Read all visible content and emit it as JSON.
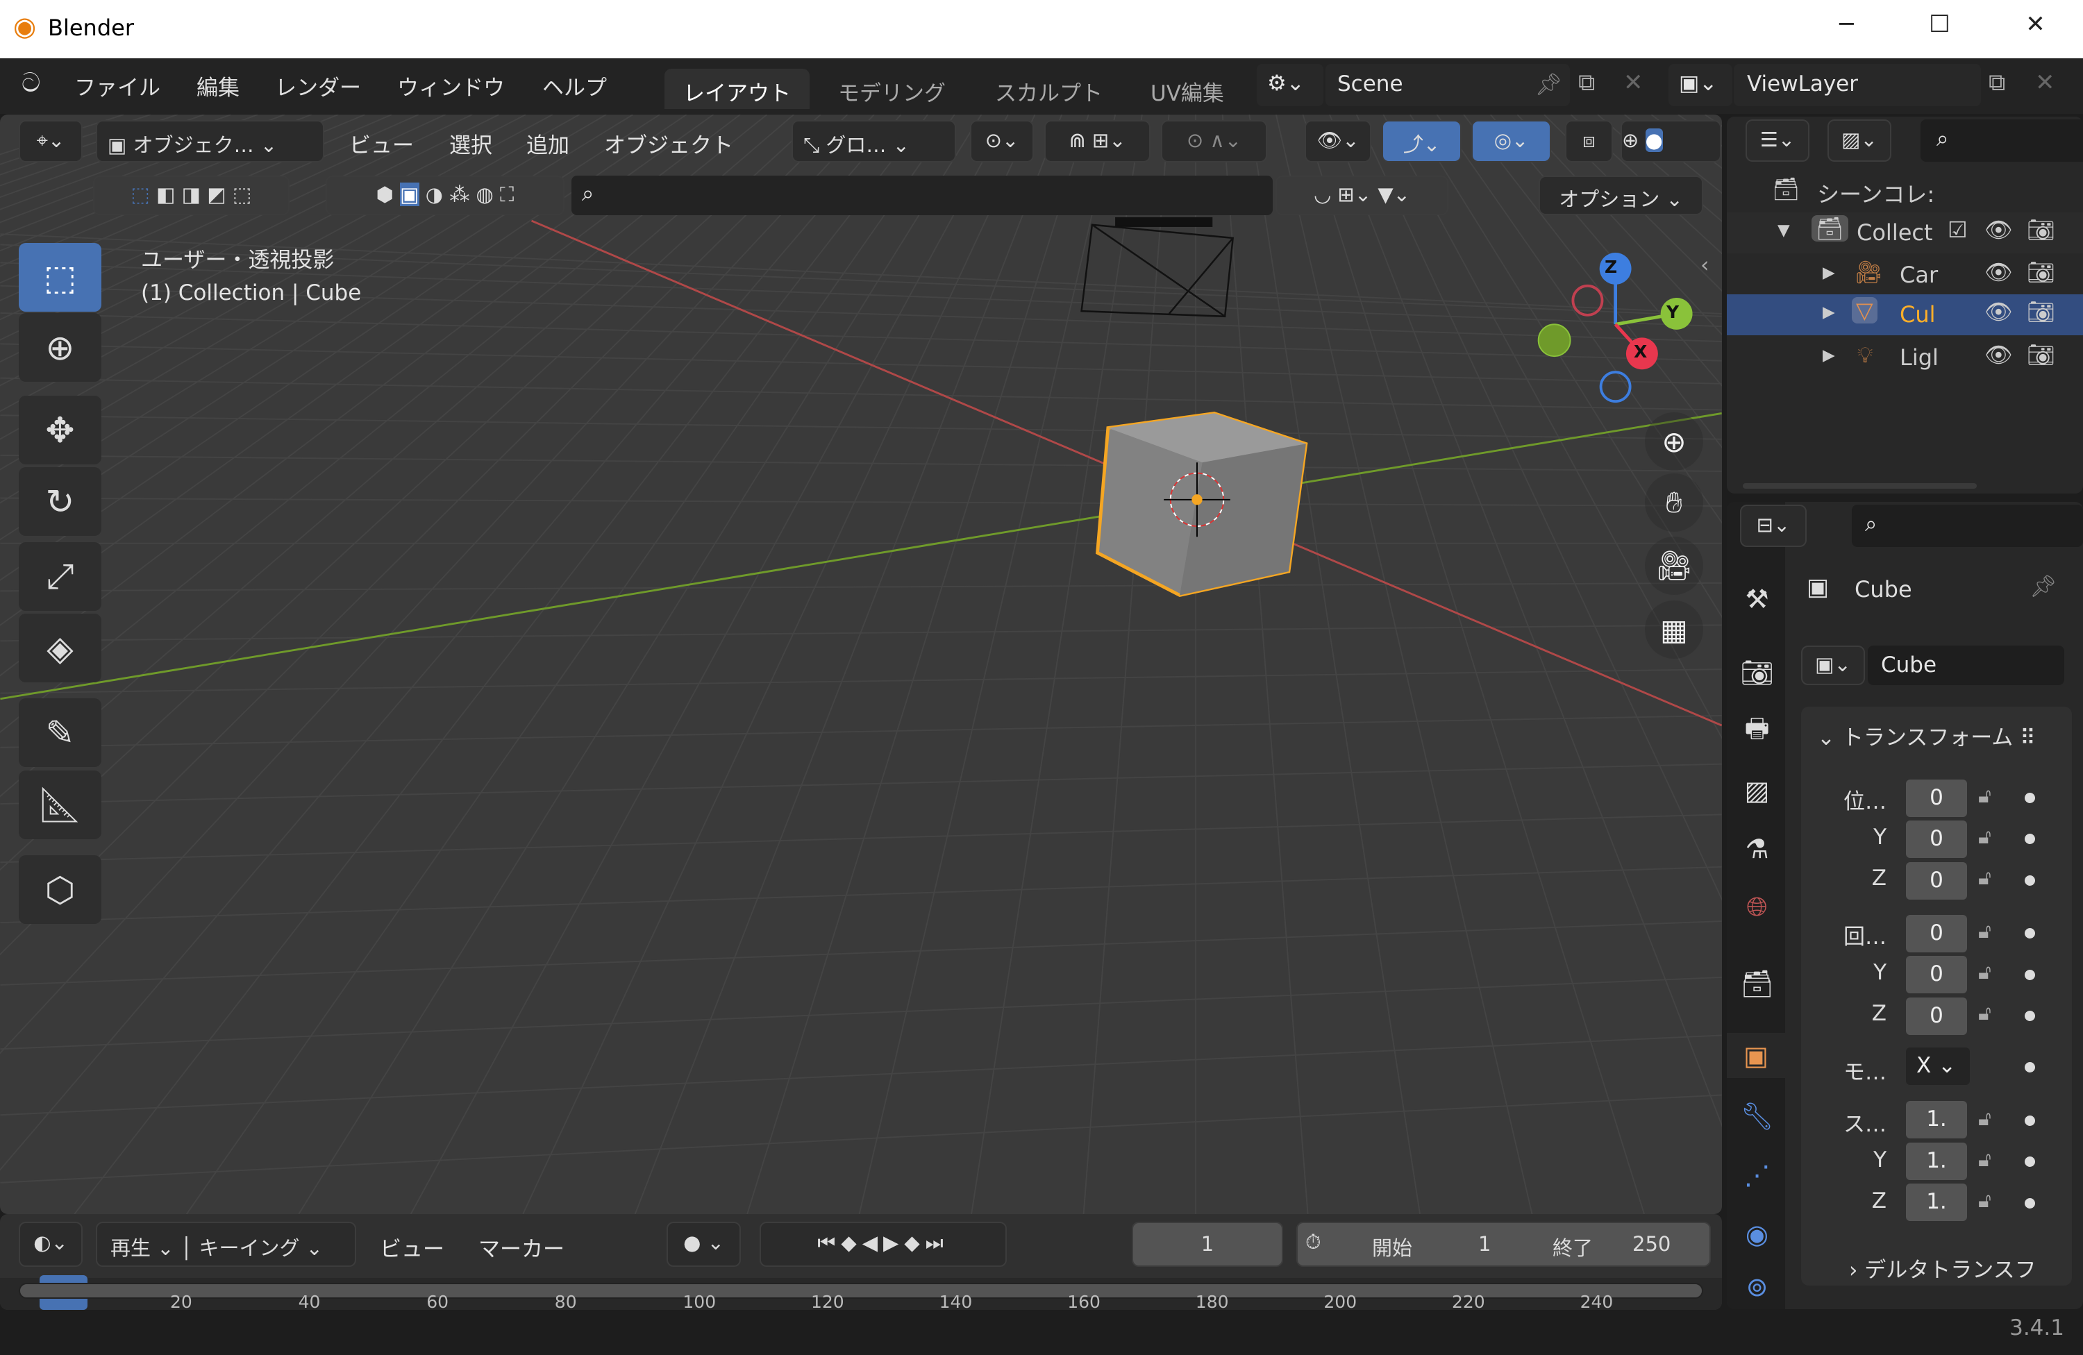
{
  "window": {
    "title": "Blender",
    "minimize": "─",
    "maximize": "☐",
    "close": "✕"
  },
  "menu": {
    "items": [
      "ファイル",
      "編集",
      "レンダー",
      "ウィンドウ",
      "ヘルプ"
    ]
  },
  "workspaces": [
    {
      "label": "レイアウト",
      "active": true
    },
    {
      "label": "モデリング"
    },
    {
      "label": "スカルプト"
    },
    {
      "label": "UV編集"
    }
  ],
  "scene": {
    "name": "Scene"
  },
  "view_layer": {
    "name": "ViewLayer"
  },
  "viewport_header": {
    "mode": "オブジェク…",
    "menus": [
      "ビュー",
      "選択",
      "追加",
      "オブジェクト"
    ],
    "orientation": "グロ…",
    "options": "オプション"
  },
  "viewport": {
    "view_name": "ユーザー・透視投影",
    "object_info": "(1) Collection | Cube",
    "gizmo": {
      "x": "X",
      "y": "Y",
      "z": "Z"
    }
  },
  "outliner": {
    "root": "シーンコレ:",
    "items": [
      {
        "label": "Collect",
        "icon": "collection-icon"
      },
      {
        "label": "Car",
        "icon": "camera-object-icon"
      },
      {
        "label": "Cul",
        "icon": "mesh-icon",
        "selected": true
      },
      {
        "label": "Ligl",
        "icon": "light-icon"
      }
    ]
  },
  "properties": {
    "object_name": "Cube",
    "data_name": "Cube",
    "panel": "トランスフォーム",
    "location_label": "位…",
    "rotation_label": "回…",
    "mode_label": "モ…",
    "mode_value": "X",
    "scale_label": "ス…",
    "axis_y": "Y",
    "axis_z": "Z",
    "location": [
      "0",
      "0",
      "0"
    ],
    "rotation": [
      "0",
      "0",
      "0"
    ],
    "scale": [
      "1.",
      "1.",
      "1."
    ],
    "delta": "デルタトランスフ"
  },
  "timeline": {
    "menus": [
      "再生",
      "キーイング",
      "ビュー",
      "マーカー"
    ],
    "current_frame": "1",
    "start_label": "開始",
    "start": "1",
    "end_label": "終了",
    "end": "250",
    "ticks": [
      "20",
      "40",
      "60",
      "80",
      "100",
      "120",
      "140",
      "160",
      "180",
      "200",
      "220",
      "240"
    ]
  },
  "status": {
    "version": "3.4.1"
  },
  "colors": {
    "accent": "#4772b3",
    "selected_outline": "#f5a623",
    "x_axis": "#c94a4a",
    "y_axis": "#7aa33a"
  }
}
